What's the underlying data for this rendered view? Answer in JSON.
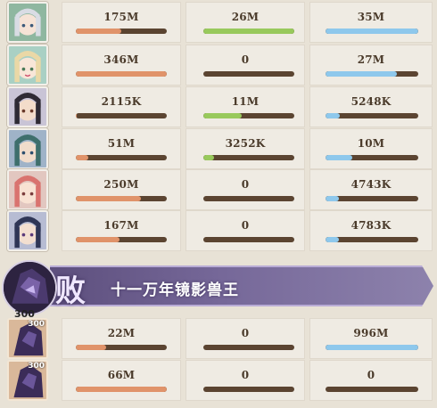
{
  "rows": [
    {
      "avatar": "character-portrait-silver-hair",
      "col1": {
        "value": "175M",
        "fill": 0.5
      },
      "col2": {
        "value": "26M",
        "fill": 1.0
      },
      "col3": {
        "value": "35M",
        "fill": 1.0
      }
    },
    {
      "avatar": "character-portrait-blonde",
      "col1": {
        "value": "346M",
        "fill": 1.0
      },
      "col2": {
        "value": "0",
        "fill": 0
      },
      "col3": {
        "value": "27M",
        "fill": 0.77
      }
    },
    {
      "avatar": "character-portrait-dark-hair",
      "col1": {
        "value": "2115K",
        "fill": 0.01
      },
      "col2": {
        "value": "11M",
        "fill": 0.42
      },
      "col3": {
        "value": "5248K",
        "fill": 0.15
      }
    },
    {
      "avatar": "character-portrait-teal-hair",
      "col1": {
        "value": "51M",
        "fill": 0.14
      },
      "col2": {
        "value": "3252K",
        "fill": 0.12
      },
      "col3": {
        "value": "10M",
        "fill": 0.29
      }
    },
    {
      "avatar": "character-portrait-red-hair",
      "col1": {
        "value": "250M",
        "fill": 0.72
      },
      "col2": {
        "value": "0",
        "fill": 0
      },
      "col3": {
        "value": "4743K",
        "fill": 0.14
      }
    },
    {
      "avatar": "character-portrait-navy-hair",
      "col1": {
        "value": "167M",
        "fill": 0.48
      },
      "col2": {
        "value": "0",
        "fill": 0
      },
      "col3": {
        "value": "4783K",
        "fill": 0.14
      }
    }
  ],
  "banner": {
    "result": "败",
    "enemy_name": "十一万年镜影兽王",
    "boss_level": "300"
  },
  "pet_rows": [
    {
      "level": "300",
      "col1": {
        "value": "22M",
        "fill": 0.33
      },
      "col2": {
        "value": "0",
        "fill": 0
      },
      "col3": {
        "value": "996M",
        "fill": 1.0
      }
    },
    {
      "level": "300",
      "col1": {
        "value": "66M",
        "fill": 1.0
      },
      "col2": {
        "value": "0",
        "fill": 0
      },
      "col3": {
        "value": "0",
        "fill": 0
      }
    }
  ],
  "colors": {
    "col1_fill": "#e0936a",
    "col2_fill": "#98c95c",
    "col3_fill": "#8ec8ec",
    "bar_track": "#5b4431",
    "banner": "#766899"
  }
}
